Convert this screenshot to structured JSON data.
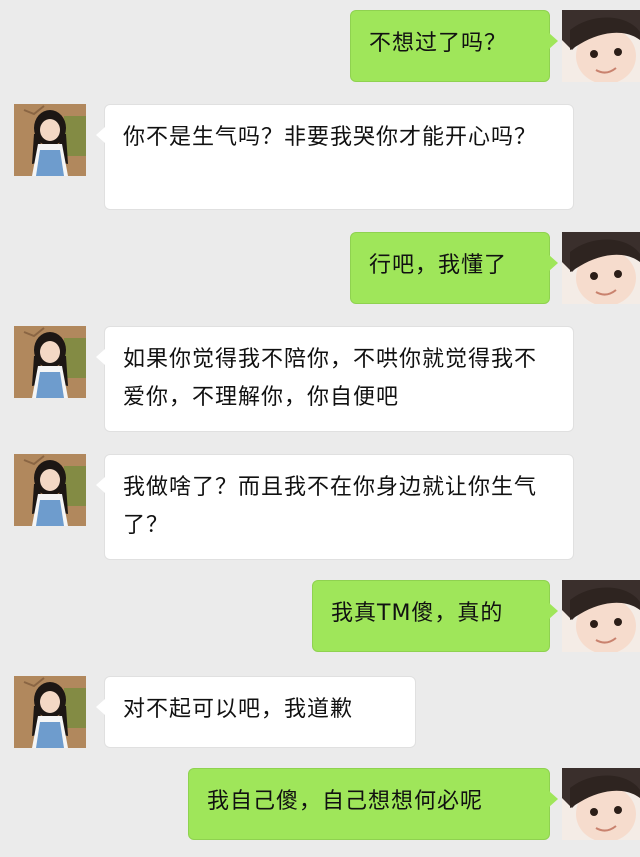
{
  "chat": {
    "messages": [
      {
        "side": "right",
        "text": "不想过了吗？"
      },
      {
        "side": "left",
        "text": "你不是生气吗？非要我哭你才能开心吗？"
      },
      {
        "side": "right",
        "text": "行吧，我懂了"
      },
      {
        "side": "left",
        "text": "如果你觉得我不陪你，不哄你就觉得我不爱你，不理解你，你自便吧"
      },
      {
        "side": "left",
        "text": "我做啥了？而且我不在你身边就让你生气了？"
      },
      {
        "side": "right",
        "text": "我真TM傻，真的"
      },
      {
        "side": "left",
        "text": "对不起可以吧，我道歉"
      },
      {
        "side": "right",
        "text": "我自己傻，自己想想何必呢"
      }
    ]
  },
  "colors": {
    "background": "#ebebeb",
    "sent_bubble": "#9fe65a",
    "received_bubble": "#ffffff"
  },
  "icons": {
    "sender_avatar": "boy-avatar-icon",
    "receiver_avatar": "girl-avatar-icon"
  }
}
